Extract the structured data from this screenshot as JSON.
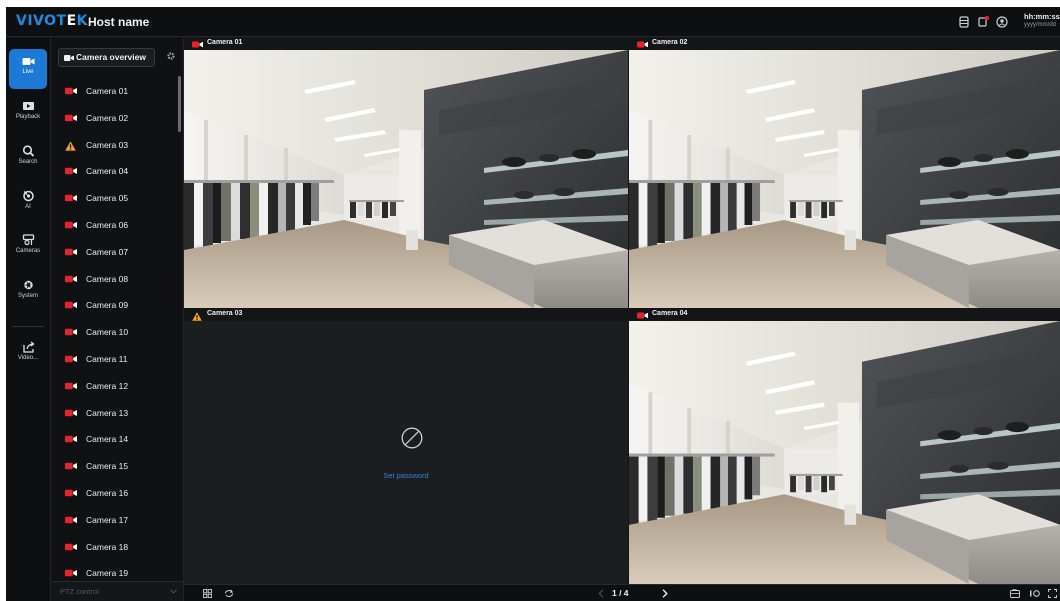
{
  "header": {
    "brand_a": "VIVOT",
    "brand_e": "E",
    "brand_b": "K",
    "host_name": "Host name",
    "time": "hh:mm:ss",
    "date": "yyyy/mm/dd",
    "icons": [
      "storage-icon",
      "alert-icon",
      "user-icon"
    ]
  },
  "nav": {
    "items": [
      {
        "label": "Live",
        "icon": "video-camera-icon",
        "active": true
      },
      {
        "label": "Playback",
        "icon": "playback-icon",
        "active": false
      },
      {
        "label": "Search",
        "icon": "search-icon",
        "active": false
      },
      {
        "label": "AI",
        "icon": "ai-icon",
        "active": false
      },
      {
        "label": "Cameras",
        "icon": "cameras-icon",
        "active": false
      },
      {
        "label": "System",
        "icon": "gear-icon",
        "active": false
      },
      {
        "label": "Video...",
        "icon": "export-icon",
        "active": false
      }
    ]
  },
  "panel": {
    "overview_label": "Camera overview",
    "cameras": [
      {
        "name": "Camera 01",
        "status": "ok"
      },
      {
        "name": "Camera 02",
        "status": "ok"
      },
      {
        "name": "Camera 03",
        "status": "warning"
      },
      {
        "name": "Camera 04",
        "status": "ok"
      },
      {
        "name": "Camera 05",
        "status": "ok"
      },
      {
        "name": "Camera 06",
        "status": "ok"
      },
      {
        "name": "Camera 07",
        "status": "ok"
      },
      {
        "name": "Camera 08",
        "status": "ok"
      },
      {
        "name": "Camera 09",
        "status": "ok"
      },
      {
        "name": "Camera 10",
        "status": "ok"
      },
      {
        "name": "Camera 11",
        "status": "ok"
      },
      {
        "name": "Camera 12",
        "status": "ok"
      },
      {
        "name": "Camera 13",
        "status": "ok"
      },
      {
        "name": "Camera 14",
        "status": "ok"
      },
      {
        "name": "Camera 15",
        "status": "ok"
      },
      {
        "name": "Camera 16",
        "status": "ok"
      },
      {
        "name": "Camera 17",
        "status": "ok"
      },
      {
        "name": "Camera 18",
        "status": "ok"
      },
      {
        "name": "Camera 19",
        "status": "ok"
      }
    ],
    "ptz_label": "PTZ control"
  },
  "grid": {
    "tiles": [
      {
        "name": "Camera 01",
        "status": "ok"
      },
      {
        "name": "Camera 02",
        "status": "ok"
      },
      {
        "name": "Camera 03",
        "status": "warning",
        "action": "Set password"
      },
      {
        "name": "Camera 04",
        "status": "ok"
      }
    ]
  },
  "footer": {
    "page_indicator": "1 / 4"
  },
  "colors": {
    "accent": "#1c79d6",
    "camera_icon": "#e8222c",
    "warning": "#f5a623",
    "link": "#2f86d8"
  }
}
